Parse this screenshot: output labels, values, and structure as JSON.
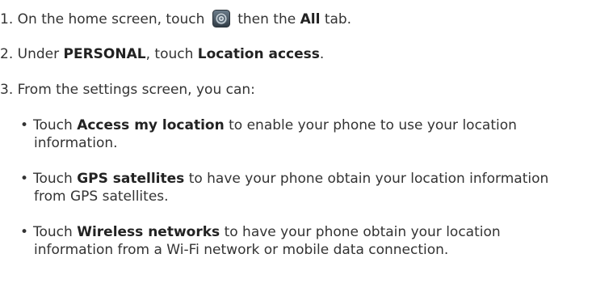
{
  "steps": [
    {
      "number": "1.",
      "pre": "On the home screen, touch",
      "icon": "settings-gear-icon",
      "mid": "then the",
      "bold": "All",
      "post": "tab."
    },
    {
      "number": "2.",
      "pre": "Under",
      "bold1": "PERSONAL",
      "mid": ", touch",
      "bold2": "Location access",
      "post": "."
    },
    {
      "number": "3.",
      "text": "From the settings screen, you can:"
    }
  ],
  "bullets": [
    {
      "symbol": "•",
      "pre": "Touch",
      "bold": "Access my location",
      "line1": "to enable your phone to use your location",
      "line2": "information."
    },
    {
      "symbol": "•",
      "pre": "Touch",
      "bold": "GPS satellites",
      "line1": "to have your phone obtain your location information",
      "line2": "from GPS satellites."
    },
    {
      "symbol": "•",
      "pre": "Touch",
      "bold": "Wireless networks",
      "line1": "to have your phone obtain your location",
      "line2": "information from a Wi-Fi network or mobile data connection."
    }
  ],
  "colors": {
    "text": "#333333",
    "bold": "#222222",
    "icon_bg": "#4a5a68",
    "icon_ring": "#9fb0bd"
  }
}
